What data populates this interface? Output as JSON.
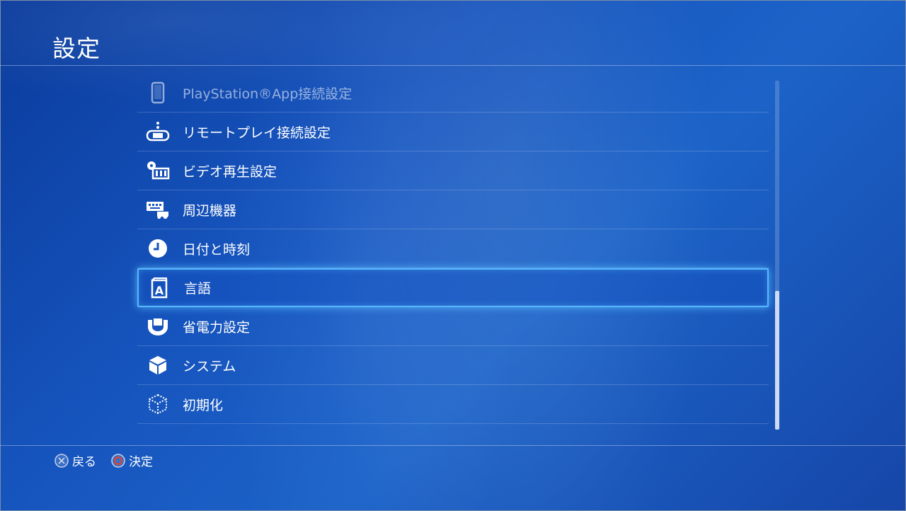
{
  "header": {
    "title": "設定"
  },
  "menu": {
    "items": [
      {
        "label": "PlayStation®App接続設定",
        "icon": "phone-icon"
      },
      {
        "label": "リモートプレイ接続設定",
        "icon": "remote-play-icon"
      },
      {
        "label": "ビデオ再生設定",
        "icon": "video-playback-icon"
      },
      {
        "label": "周辺機器",
        "icon": "devices-icon"
      },
      {
        "label": "日付と時刻",
        "icon": "clock-icon"
      },
      {
        "label": "言語",
        "icon": "language-icon"
      },
      {
        "label": "省電力設定",
        "icon": "power-save-icon"
      },
      {
        "label": "システム",
        "icon": "system-cube-icon"
      },
      {
        "label": "初期化",
        "icon": "initialize-cube-icon"
      }
    ],
    "selected_index": 5
  },
  "footer": {
    "back_label": "戻る",
    "confirm_label": "決定"
  },
  "colors": {
    "background": "#1654bd",
    "highlight_border": "#56b7ff",
    "circle_button": "#e0452f"
  }
}
